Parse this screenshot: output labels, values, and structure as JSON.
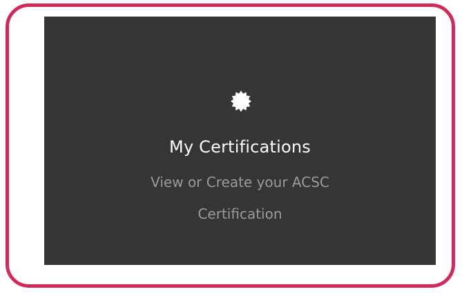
{
  "card": {
    "icon": "certificate-badge-icon",
    "title": "My Certifications",
    "description_line1": "View or Create your ACSC",
    "description_line2": "Certification"
  },
  "colors": {
    "border_accent": "#cf2a5a",
    "card_background": "#353535",
    "title_text": "#ffffff",
    "description_text": "#9b9b9b"
  }
}
